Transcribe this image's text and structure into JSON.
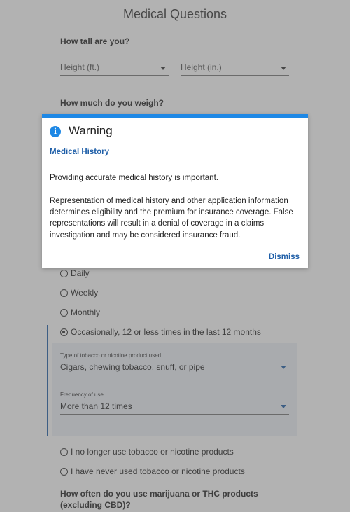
{
  "page": {
    "title": "Medical Questions",
    "height_question": "How tall are you?",
    "height_ft_placeholder": "Height (ft.)",
    "height_in_placeholder": "Height (in.)",
    "weight_question": "How much do you weigh?"
  },
  "tobacco": {
    "options": {
      "daily": "Daily",
      "weekly": "Weekly",
      "monthly": "Monthly",
      "occasionally": "Occasionally, 12 or less times in the last 12 months",
      "no_longer": "I no longer use tobacco or nicotine products",
      "never": "I have never used tobacco or nicotine products"
    },
    "selected": "occasionally",
    "type_label": "Type of tobacco or nicotine product used",
    "type_value": "Cigars, chewing tobacco, snuff, or pipe",
    "frequency_label": "Frequency of use",
    "frequency_value": "More than 12 times"
  },
  "marijuana_question": "How often do you use marijuana or THC products (excluding CBD)?",
  "modal": {
    "icon": "info-icon",
    "title": "Warning",
    "subtitle": "Medical History",
    "paragraph1": "Providing accurate medical history is important.",
    "paragraph2": "Representation of medical history and other application information determines eligibility and the premium for insurance coverage. False representations will result in a denial of coverage in a claims investigation and may be considered insurance fraud.",
    "dismiss_label": "Dismiss"
  },
  "colors": {
    "accent": "#1e88e5",
    "link": "#1f5fa8",
    "overlay": "#5f5f5f"
  }
}
